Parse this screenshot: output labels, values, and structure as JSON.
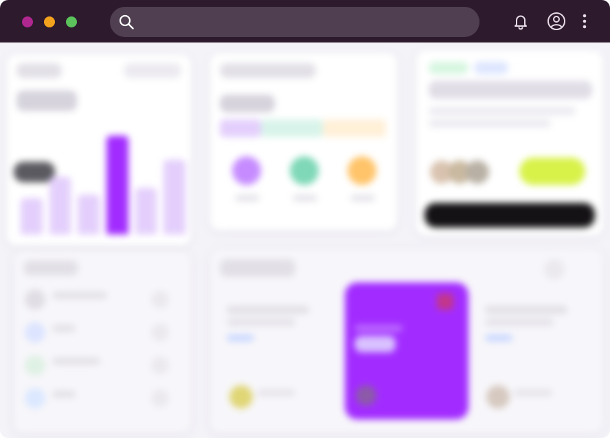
{
  "window": {
    "title": ""
  },
  "titlebar": {
    "traffic_lights": [
      {
        "name": "close",
        "color": "#b0278f"
      },
      {
        "name": "minimize",
        "color": "#f3a21d"
      },
      {
        "name": "maximize",
        "color": "#5cc25c"
      }
    ],
    "search": {
      "value": "",
      "placeholder": ""
    },
    "icons": [
      "search-icon",
      "bell-icon",
      "user-circle-icon",
      "more-vertical-icon"
    ]
  },
  "colors": {
    "titlebar": "#2d1a2d",
    "search_bg": "#4f3f51",
    "accent_purple": "#a22cff",
    "light_purple": "#e4cffc",
    "teal": "#9ee3c9",
    "orange": "#ffd8a0",
    "yellow_green": "#d9f24a",
    "dark_button": "#141214"
  },
  "dashboard": {
    "revenue_card": {
      "title": "",
      "amount": "",
      "badge": "",
      "bar_levels": [
        0.35,
        0.55,
        0.38,
        0.95,
        0.45,
        0.72
      ]
    },
    "breakdown_card": {
      "title": "",
      "amount": "",
      "legend": [
        "",
        "",
        ""
      ]
    },
    "promo_card": {
      "tags": [
        "",
        ""
      ],
      "headline": "",
      "cta": ""
    },
    "list_card": {
      "title": "",
      "items": [
        "",
        "",
        "",
        ""
      ]
    },
    "schedule_card": {
      "title": "",
      "columns": [
        "",
        "",
        ""
      ]
    }
  }
}
